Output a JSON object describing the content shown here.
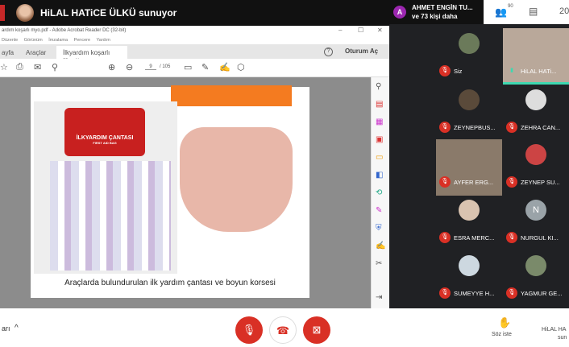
{
  "presenter_bar": {
    "title": "HiLAL HATiCE ÜLKÜ sunuyor"
  },
  "acrobat": {
    "title": "ardım koşarlı myo.pdf - Adobe Acrobat Reader DC (32-bit)",
    "menu": [
      "Düzenle",
      "Görünüm",
      "İmzalama",
      "Pencere",
      "Yardım"
    ],
    "tabs": [
      "ayfa",
      "Araçlar",
      "İlkyardım koşarlı m...  ×"
    ],
    "help_icon": "?",
    "signin": "Oturum Aç",
    "page_current": "9",
    "page_total": "/ 105",
    "slide_caption": "Araçlarda bulundurulan ilk yardım çantası ve boyun korsesi",
    "bag_label": "İLKYARDIM ÇANTASI",
    "bag_sub": "FIRST AID BAG"
  },
  "meet": {
    "tooltip_name": "AHMET ENGİN TU...",
    "tooltip_more": "ve 73 kişi daha",
    "tooltip_avatar": "A",
    "people_count": "90",
    "clock": "20",
    "participants": [
      {
        "name": "Siz",
        "avatar": ""
      },
      {
        "name": "HiLAL HATi...",
        "avatar": ""
      },
      {
        "name": "ZEYNEPBUS...",
        "avatar": ""
      },
      {
        "name": "ZEHRA CAN...",
        "avatar": ""
      },
      {
        "name": "AYFER ERG...",
        "avatar": ""
      },
      {
        "name": "ZEYNEP SU...",
        "avatar": ""
      },
      {
        "name": "ESRA MERC...",
        "avatar": ""
      },
      {
        "name": "NURGUL KI...",
        "avatar": "N"
      },
      {
        "name": "SUMEYYE H...",
        "avatar": ""
      },
      {
        "name": "YAGMUR GE...",
        "avatar": ""
      }
    ],
    "bottom": {
      "left_label": "arı",
      "raise_hand": "Söz iste",
      "presenter": "HiLAL HA",
      "presenter2": "sun"
    }
  },
  "colors": {
    "accent_red": "#d93025",
    "orange": "#f47b20",
    "panel": "#202124"
  }
}
